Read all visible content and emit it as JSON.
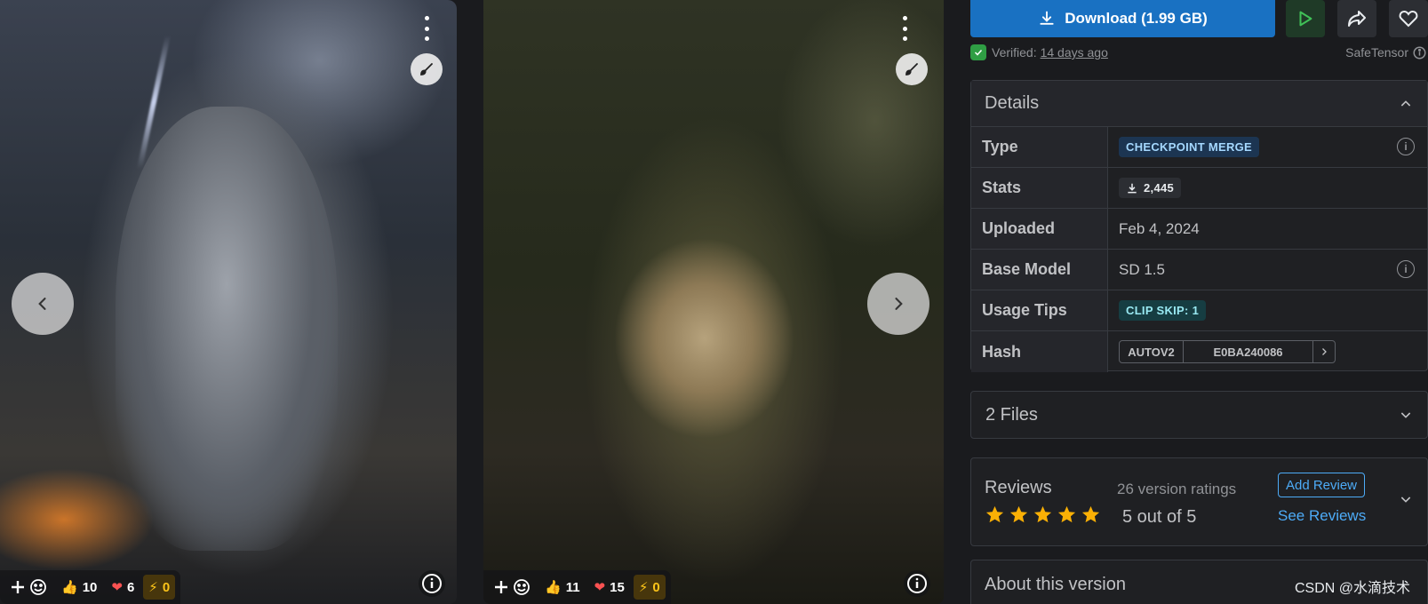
{
  "gallery": {
    "cards": [
      {
        "reactions": {
          "likes": "10",
          "hearts": "6",
          "buzz": "0"
        }
      },
      {
        "reactions": {
          "likes": "11",
          "hearts": "15",
          "buzz": "0"
        }
      }
    ]
  },
  "actions": {
    "download_label": "Download (1.99 GB)"
  },
  "verification": {
    "verified_label": "Verified:",
    "verified_ago": "14 days ago",
    "format": "SafeTensor"
  },
  "details": {
    "title": "Details",
    "rows": {
      "type": {
        "label": "Type",
        "value": "CHECKPOINT MERGE"
      },
      "stats": {
        "label": "Stats",
        "value": "2,445"
      },
      "uploaded": {
        "label": "Uploaded",
        "value": "Feb 4, 2024"
      },
      "base_model": {
        "label": "Base Model",
        "value": "SD 1.5"
      },
      "usage_tips": {
        "label": "Usage Tips",
        "value": "CLIP SKIP: 1"
      },
      "hash": {
        "label": "Hash",
        "algo": "AUTOV2",
        "value": "E0BA240086"
      }
    }
  },
  "files": {
    "title": "2 Files"
  },
  "reviews": {
    "title": "Reviews",
    "count_label": "26 version ratings",
    "stars": 5,
    "average_label": "5 out of 5",
    "add_review": "Add Review",
    "see_reviews": "See Reviews"
  },
  "about": {
    "title": "About this version"
  },
  "watermark": "CSDN @水滴技术",
  "colors": {
    "accent": "#1971c2",
    "link": "#4dabf7",
    "star": "#fab005",
    "heart": "#fa5252",
    "buzz": "#fcc419"
  }
}
